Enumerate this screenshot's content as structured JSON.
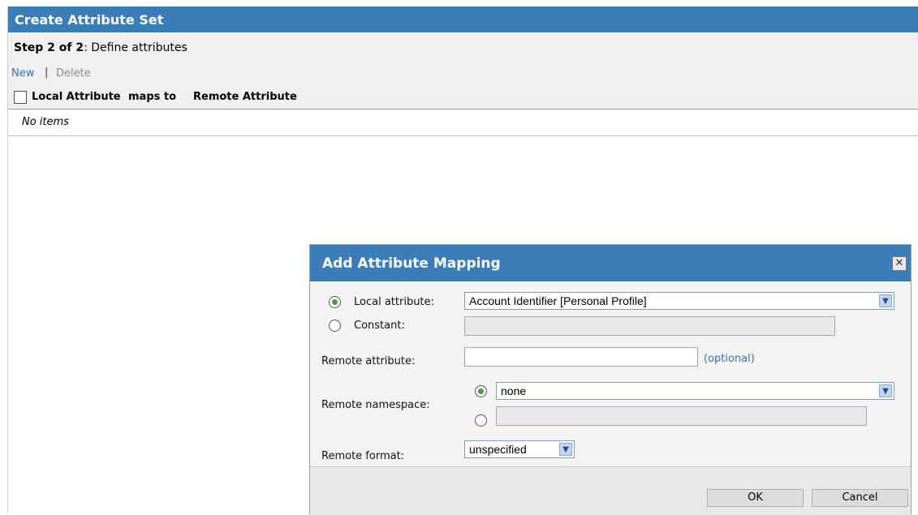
{
  "page": {
    "title": "Create Attribute Set",
    "step_prefix": "Step 2 of 2",
    "step_suffix": ": Define attributes",
    "actions": {
      "new": "New",
      "separator": "|",
      "delete": "Delete"
    },
    "table": {
      "headers": [
        "Local Attribute",
        "maps to",
        "Remote Attribute"
      ],
      "empty_text": "No items"
    }
  },
  "dialog": {
    "title": "Add Attribute Mapping",
    "close_icon": "close-icon",
    "local_attribute_label": "Local attribute:",
    "local_attribute_value": "Account Identifier [Personal Profile]",
    "constant_label": "Constant:",
    "remote_attribute_label": "Remote attribute:",
    "remote_attribute_hint": "(optional)",
    "remote_namespace_label": "Remote namespace:",
    "remote_namespace_value": "none",
    "remote_format_label": "Remote format:",
    "remote_format_value": "unspecified",
    "ok_label": "OK",
    "cancel_label": "Cancel"
  },
  "colors": {
    "header_blue": "#3a7db9",
    "link": "#3a6ea5",
    "radio_selected": "#4a9a4a"
  }
}
